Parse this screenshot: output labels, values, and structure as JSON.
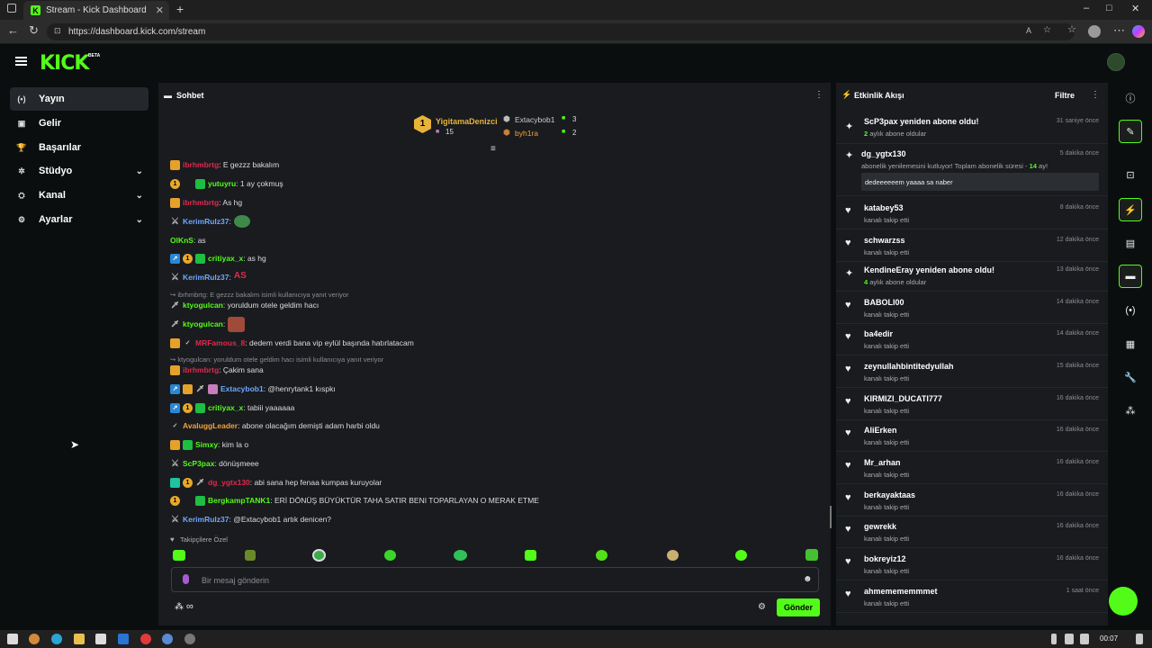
{
  "browser": {
    "tab_title": "Stream - Kick Dashboard",
    "tab_favicon": "K",
    "url": "https://dashboard.kick.com/stream",
    "new_tab": "+",
    "min": "–",
    "max": "□",
    "close": "✕",
    "tab_close": "✕"
  },
  "header": {
    "logo": "KICK",
    "beta": "BETA"
  },
  "sidebar": {
    "items": [
      {
        "label": "Yayın",
        "icon": "broadcast-icon",
        "glyph": "(•)"
      },
      {
        "label": "Gelir",
        "icon": "revenue-icon",
        "glyph": "▣"
      },
      {
        "label": "Başarılar",
        "icon": "trophy-icon",
        "glyph": "🏆"
      },
      {
        "label": "Stüdyo",
        "icon": "studio-icon",
        "glyph": "✲"
      },
      {
        "label": "Kanal",
        "icon": "channel-icon",
        "glyph": "⛭"
      },
      {
        "label": "Ayarlar",
        "icon": "settings-icon",
        "glyph": "⚙"
      }
    ]
  },
  "chat": {
    "title": "Sohbet",
    "leaderboard": {
      "first": {
        "rank": "1",
        "name": "YigitamaDenizci",
        "count": "15"
      },
      "others": [
        {
          "name": "Extacybob1",
          "count": "3"
        },
        {
          "name": "byh1ra",
          "count": "2"
        }
      ]
    },
    "messages": [
      {
        "user": "ibrhmbrtg",
        "color": "#e0294d",
        "text": ": E gezzz bakalım"
      },
      {
        "user": "yutuyru",
        "color": "#53fc18",
        "text": ": 1 ay çokmuş"
      },
      {
        "user": "ibrhmbrtg",
        "color": "#e0294d",
        "text": ": As hg"
      },
      {
        "user": "KerimRulz37",
        "color": "#6fa8ff",
        "text": ":"
      },
      {
        "user": "OlKnS",
        "color": "#53fc18",
        "text": ": as"
      },
      {
        "user": "critiyax_x",
        "color": "#53fc18",
        "text": ": as hg"
      },
      {
        "user": "KerimRulz37",
        "color": "#6fa8ff",
        "text": ":"
      },
      {
        "user": "ktyogulcan",
        "color": "#53fc18",
        "text": ": yoruldum otele geldim hacı"
      },
      {
        "user": "ktyogulcan",
        "color": "#53fc18",
        "text": ":"
      },
      {
        "user": "MRFamous_8",
        "color": "#e0294d",
        "text": ": dedem verdi bana vip eylül başında hatırlatacam"
      },
      {
        "user": "ibrhmbrtg",
        "color": "#e0294d",
        "text": ": Çakim sana"
      },
      {
        "user": "Extacybob1",
        "color": "#6fa8ff",
        "text": ": @henrytank1 kıspkı"
      },
      {
        "user": "critiyax_x",
        "color": "#53fc18",
        "text": ": tabiii yaaaaaa"
      },
      {
        "user": "AvaluggLeader",
        "color": "#f2a33a",
        "text": ": abone olacağım demişti adam harbi oldu"
      },
      {
        "user": "Simxy",
        "color": "#53fc18",
        "text": ": kim la o"
      },
      {
        "user": "ScP3pax",
        "color": "#53fc18",
        "text": ": dönüşmeee"
      },
      {
        "user": "dg_ygtx130",
        "color": "#e0294d",
        "text": ": abi sana hep fenaa kumpas kuruyolar"
      },
      {
        "user": "BergkampTANK1",
        "color": "#53fc18",
        "text": ": ERİ DÖNÜŞ BÜYÜKTÜR TAHA SATIR BENI TOPARLAYAN O MERAK ETME"
      },
      {
        "user": "KerimRulz37",
        "color": "#6fa8ff",
        "text": ": @Extacybob1 artık denicen?"
      }
    ],
    "reply1": "ibrhmbrtg: E gezzz bakalım isimli kullanıcıya yanıt veriyor",
    "reply2": "ktyogulcan: yoruldum otele geldim hacı isimli kullanıcıya yanıt veriyor",
    "followers_only": "Takipçilere Özel",
    "input_placeholder": "Bir mesaj gönderin",
    "send": "Gönder",
    "emote_count": "∞"
  },
  "activity": {
    "title": "Etkinlik Akışı",
    "filter": "Filtre",
    "items": [
      {
        "name": "ScP3pax yeniden abone oldu!",
        "sub_num": "2",
        "sub": " aylık abone oldular",
        "time": "31 saniye önce",
        "icon": "sparkle-icon"
      },
      {
        "name": "dg_ygtx130",
        "sub": "abonelik yenilemesini kutluyor! Toplam abonelik süresi - ",
        "sub_num2": "14",
        "sub_tail": " ay!",
        "msg": "dedeeeeeem yaaaa sa naber",
        "time": "5 dakika önce",
        "icon": "sparkle-icon"
      },
      {
        "name": "katabey53",
        "sub": "kanalı takip etti",
        "time": "8 dakika önce",
        "icon": "heart-icon"
      },
      {
        "name": "schwarzss",
        "sub": "kanalı takip etti",
        "time": "12 dakika önce",
        "icon": "heart-icon"
      },
      {
        "name": "KendineEray yeniden abone oldu!",
        "sub_num": "4",
        "sub": " aylık abone oldular",
        "time": "13 dakika önce",
        "icon": "sparkle-icon"
      },
      {
        "name": "BABOLI00",
        "sub": "kanalı takip etti",
        "time": "14 dakika önce",
        "icon": "heart-icon"
      },
      {
        "name": "ba4edir",
        "sub": "kanalı takip etti",
        "time": "14 dakika önce",
        "icon": "heart-icon"
      },
      {
        "name": "zeynullahbintitedyullah",
        "sub": "kanalı takip etti",
        "time": "15 dakika önce",
        "icon": "heart-icon"
      },
      {
        "name": "KIRMIZI_DUCATI777",
        "sub": "kanalı takip etti",
        "time": "16 dakika önce",
        "icon": "heart-icon"
      },
      {
        "name": "AliErken",
        "sub": "kanalı takip etti",
        "time": "16 dakika önce",
        "icon": "heart-icon"
      },
      {
        "name": "Mr_arhan",
        "sub": "kanalı takip etti",
        "time": "16 dakika önce",
        "icon": "heart-icon"
      },
      {
        "name": "berkayaktaas",
        "sub": "kanalı takip etti",
        "time": "16 dakika önce",
        "icon": "heart-icon"
      },
      {
        "name": "gewrekk",
        "sub": "kanalı takip etti",
        "time": "16 dakika önce",
        "icon": "heart-icon"
      },
      {
        "name": "bokreyiz12",
        "sub": "kanalı takip etti",
        "time": "16 dakika önce",
        "icon": "heart-icon"
      },
      {
        "name": "ahmemememmmet",
        "sub": "kanalı takip etti",
        "time": "1 saat önce",
        "icon": "heart-icon"
      }
    ]
  },
  "taskbar": {
    "time": "00:07"
  },
  "colors": {
    "accent": "#53fc18",
    "panel": "#191b1f",
    "bg": "#0b0e0f"
  }
}
